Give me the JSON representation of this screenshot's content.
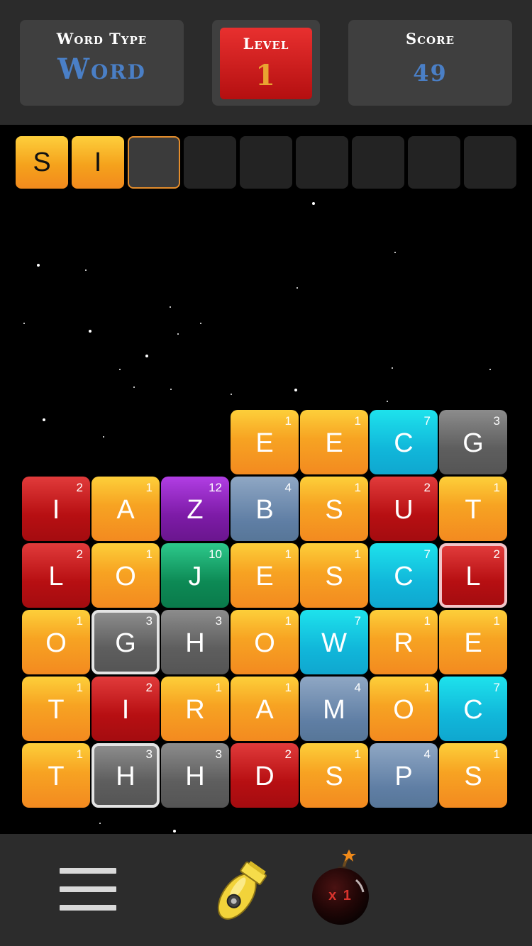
{
  "header": {
    "word_type_label": "Word Type",
    "word_type_value": "Word",
    "level_label": "Level",
    "level_value": "1",
    "score_label": "Score",
    "score_value": "49"
  },
  "word_slots": [
    "S",
    "I",
    "",
    "",
    "",
    "",
    "",
    "",
    ""
  ],
  "board": {
    "rows": [
      [
        null,
        null,
        null,
        {
          "letter": "E",
          "points": "1",
          "color": "orange"
        },
        {
          "letter": "E",
          "points": "1",
          "color": "orange"
        },
        {
          "letter": "C",
          "points": "7",
          "color": "cyan"
        },
        {
          "letter": "G",
          "points": "3",
          "color": "gray"
        }
      ],
      [
        {
          "letter": "I",
          "points": "2",
          "color": "red"
        },
        {
          "letter": "A",
          "points": "1",
          "color": "orange"
        },
        {
          "letter": "Z",
          "points": "12",
          "color": "purple"
        },
        {
          "letter": "B",
          "points": "4",
          "color": "blue"
        },
        {
          "letter": "S",
          "points": "1",
          "color": "orange"
        },
        {
          "letter": "U",
          "points": "2",
          "color": "red"
        },
        {
          "letter": "T",
          "points": "1",
          "color": "orange"
        }
      ],
      [
        {
          "letter": "L",
          "points": "2",
          "color": "red"
        },
        {
          "letter": "O",
          "points": "1",
          "color": "orange"
        },
        {
          "letter": "J",
          "points": "10",
          "color": "green"
        },
        {
          "letter": "E",
          "points": "1",
          "color": "orange"
        },
        {
          "letter": "S",
          "points": "1",
          "color": "orange"
        },
        {
          "letter": "C",
          "points": "7",
          "color": "cyan"
        },
        {
          "letter": "L",
          "points": "2",
          "color": "red",
          "highlight": "pink"
        }
      ],
      [
        {
          "letter": "O",
          "points": "1",
          "color": "orange"
        },
        {
          "letter": "G",
          "points": "3",
          "color": "gray",
          "highlight": "white"
        },
        {
          "letter": "H",
          "points": "3",
          "color": "gray"
        },
        {
          "letter": "O",
          "points": "1",
          "color": "orange"
        },
        {
          "letter": "W",
          "points": "7",
          "color": "cyan"
        },
        {
          "letter": "R",
          "points": "1",
          "color": "orange"
        },
        {
          "letter": "E",
          "points": "1",
          "color": "orange"
        }
      ],
      [
        {
          "letter": "T",
          "points": "1",
          "color": "orange"
        },
        {
          "letter": "I",
          "points": "2",
          "color": "red"
        },
        {
          "letter": "R",
          "points": "1",
          "color": "orange"
        },
        {
          "letter": "A",
          "points": "1",
          "color": "orange"
        },
        {
          "letter": "M",
          "points": "4",
          "color": "blue"
        },
        {
          "letter": "O",
          "points": "1",
          "color": "orange"
        },
        {
          "letter": "C",
          "points": "7",
          "color": "cyan"
        }
      ],
      [
        {
          "letter": "T",
          "points": "1",
          "color": "orange"
        },
        {
          "letter": "H",
          "points": "3",
          "color": "gray",
          "highlight": "white"
        },
        {
          "letter": "H",
          "points": "3",
          "color": "gray"
        },
        {
          "letter": "D",
          "points": "2",
          "color": "red"
        },
        {
          "letter": "S",
          "points": "1",
          "color": "orange"
        },
        {
          "letter": "P",
          "points": "4",
          "color": "blue"
        },
        {
          "letter": "S",
          "points": "1",
          "color": "orange"
        }
      ]
    ]
  },
  "footer": {
    "menu_icon": "hamburger-menu-icon",
    "rocket_icon": "rocket-powerup-icon",
    "bomb_icon": "bomb-powerup-icon",
    "bomb_count": "x 1"
  },
  "colors": {
    "orange": "#f7a322",
    "red": "#b70f12",
    "purple": "#7d1ba7",
    "blue": "#5f7ea4",
    "cyan": "#11b7da",
    "gray": "#5e5e5e",
    "green": "#0d8a55",
    "accent_text": "#4a7fc6",
    "level_value": "#e9a431"
  }
}
